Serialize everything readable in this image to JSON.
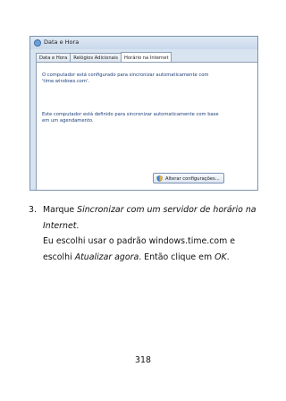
{
  "dialog": {
    "title": "Data e Hora",
    "tabs": [
      "Data e Hora",
      "Relógios Adicionais",
      "Horário na Internet"
    ],
    "message1": [
      "O computador está configurado para sincronizar automaticamente com",
      "'time.windows.com'."
    ],
    "message2": [
      "Este computador está definido para sincronizar automaticamente com base",
      "em um agendamento."
    ],
    "change_button": "Alterar configurações..."
  },
  "step": {
    "number": "3.",
    "line1_prefix": "Marque ",
    "line1_italic": "Sincronizar com um servidor de horário na",
    "line2_italic": "Internet",
    "line2_suffix": ".",
    "line3": "Eu escolhi usar o padrão windows.time.com e",
    "line4_prefix": "escolhi ",
    "line4_italic": "Atualizar agora",
    "line4_middle": ". Então clique em ",
    "line4_ok": "OK",
    "line4_end": "."
  },
  "page_number": "318"
}
